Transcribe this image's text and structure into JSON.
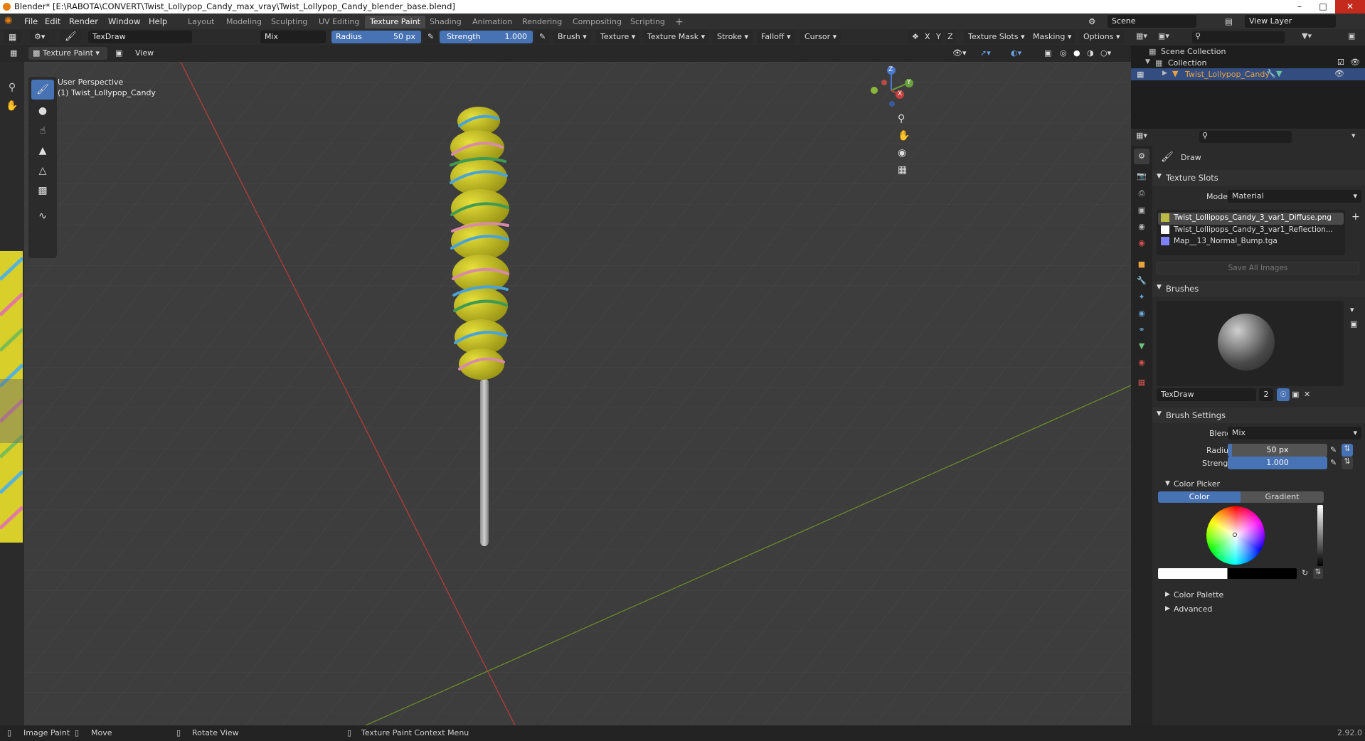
{
  "window": {
    "title": "Blender* [E:\\RABOTA\\CONVERT\\Twist_Lollypop_Candy_max_vray\\Twist_Lollypop_Candy_blender_base.blend]"
  },
  "menu": {
    "items": [
      "File",
      "Edit",
      "Render",
      "Window",
      "Help"
    ]
  },
  "workspaces": {
    "tabs": [
      "Layout",
      "Modeling",
      "Sculpting",
      "UV Editing",
      "Texture Paint",
      "Shading",
      "Animation",
      "Rendering",
      "Compositing",
      "Scripting"
    ],
    "active": "Texture Paint",
    "add": "+"
  },
  "scene": {
    "name": "Scene",
    "view_layer": "View Layer"
  },
  "tool_header": {
    "brush_name": "TexDraw",
    "blend": "Mix",
    "radius_label": "Radius",
    "radius_value": "50 px",
    "strength_label": "Strength",
    "strength_value": "1.000",
    "menus": [
      "Brush",
      "Texture",
      "Texture Mask",
      "Stroke",
      "Falloff",
      "Cursor"
    ],
    "axes": [
      "X",
      "Y",
      "Z"
    ],
    "right_menus": [
      "Texture Slots",
      "Masking",
      "Options"
    ]
  },
  "mode_header": {
    "mode": "Texture Paint",
    "view": "View"
  },
  "viewport": {
    "line1": "User Perspective",
    "line2": "(1) Twist_Lollypop_Candy",
    "gizmo": {
      "z": "Z",
      "y": "Y",
      "x": "X"
    }
  },
  "outliner": {
    "scene_collection": "Scene Collection",
    "collection": "Collection",
    "object": "Twist_Lollypop_Candy"
  },
  "properties": {
    "tool_name": "Draw",
    "texture_slots": {
      "title": "Texture Slots",
      "mode_label": "Mode",
      "mode_value": "Material",
      "slots": [
        "Twist_Lollipops_Candy_3_var1_Diffuse.png",
        "Twist_Lollipops_Candy_3_var1_Reflection...",
        "Map__13_Normal_Bump.tga"
      ],
      "slot_colors": [
        "#b9b946",
        "#ffffff",
        "#8080ff"
      ],
      "save_all": "Save All Images"
    },
    "brushes": {
      "title": "Brushes",
      "name": "TexDraw",
      "users": "2"
    },
    "brush_settings": {
      "title": "Brush Settings",
      "blend_label": "Blend",
      "blend_value": "Mix",
      "radius_label": "Radius",
      "radius_value": "50 px",
      "strength_label": "Strength",
      "strength_value": "1.000"
    },
    "color_picker": {
      "title": "Color Picker",
      "tab_color": "Color",
      "tab_gradient": "Gradient"
    },
    "color_palette": "Color Palette",
    "advanced": "Advanced"
  },
  "status": {
    "items": [
      "Image Paint",
      "Move",
      "Rotate View",
      "Texture Paint Context Menu"
    ],
    "version": "2.92.0"
  },
  "colors": {
    "accent": "#4772b3",
    "header": "#303030",
    "viewport": "#3d3d3d",
    "selection": "#334d80",
    "object_orange": "#e8a33d"
  }
}
